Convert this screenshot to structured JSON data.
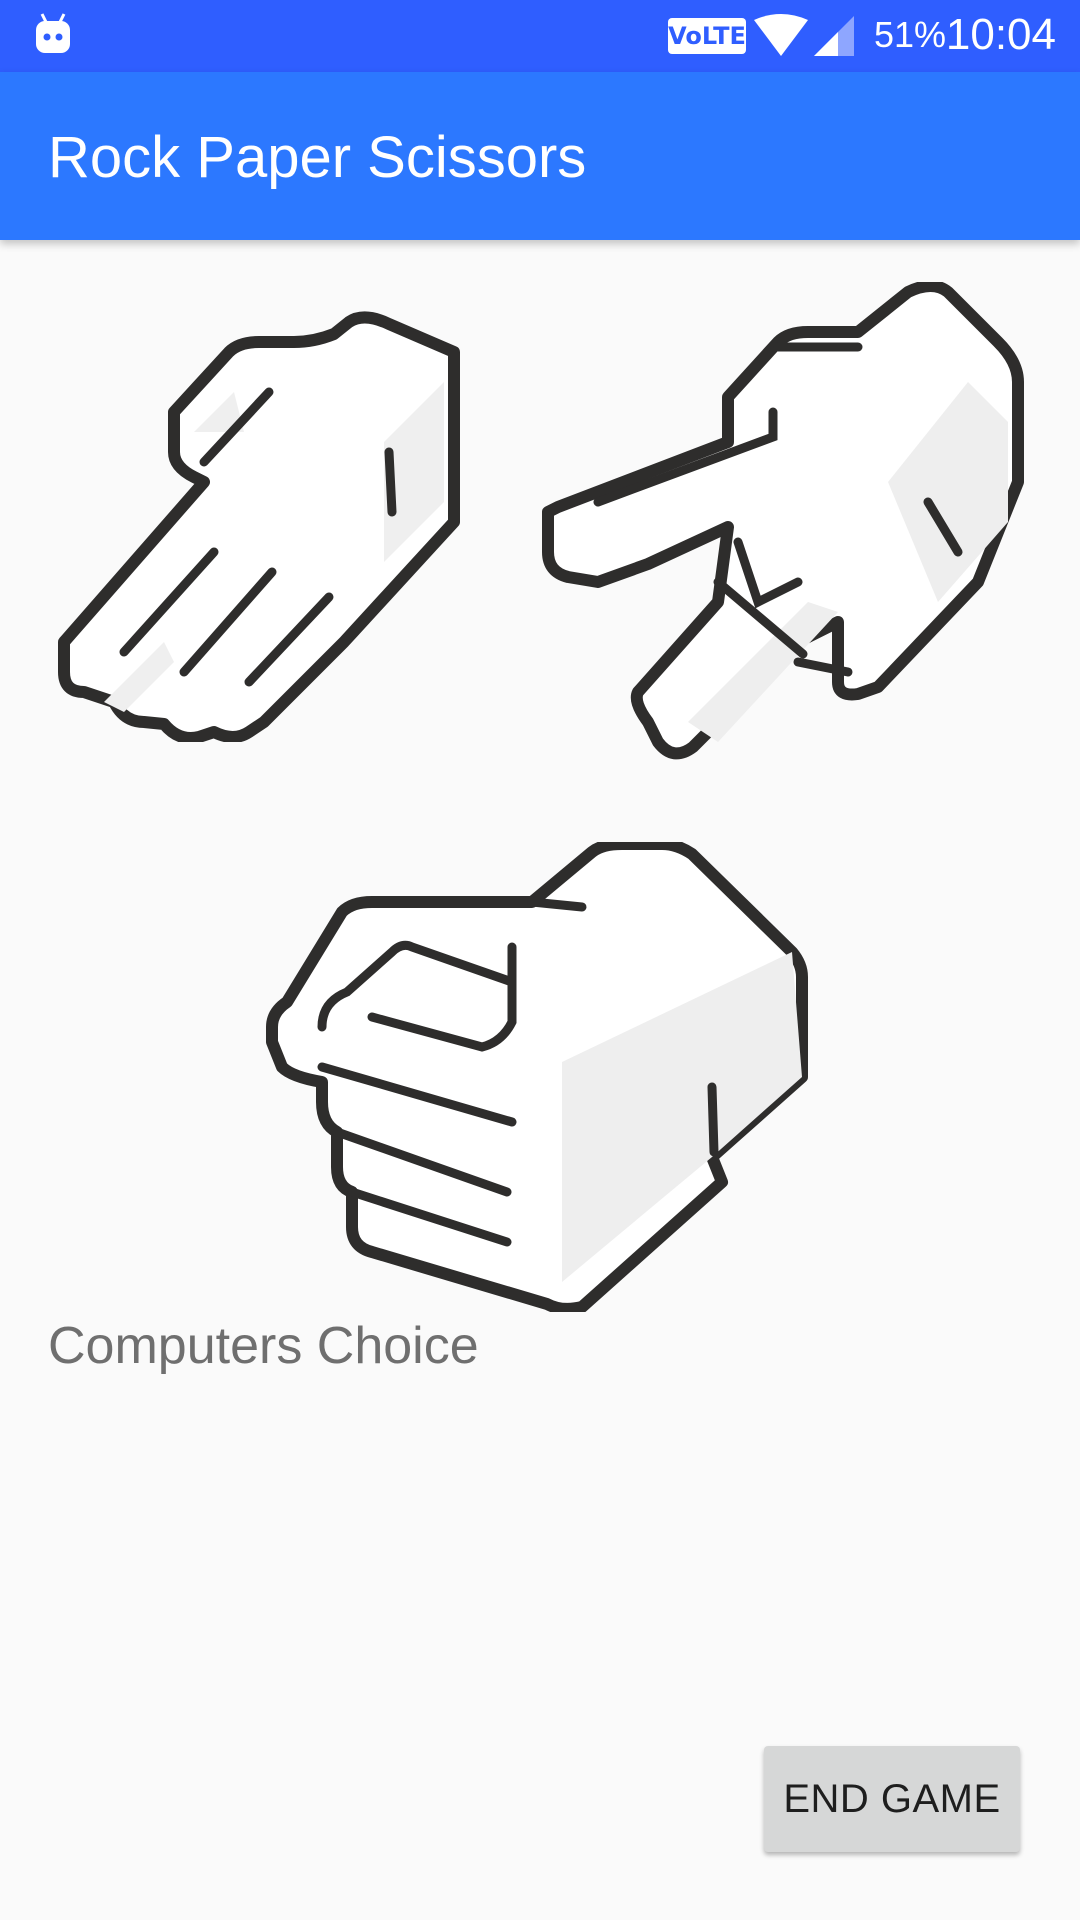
{
  "status_bar": {
    "notification_icon": "android-bot-icon",
    "network_badge": "VoLTE",
    "wifi_icon": "wifi-icon",
    "signal_icon": "cell-signal-icon",
    "battery_percent": "51%",
    "time": "10:04"
  },
  "app_bar": {
    "title": "Rock Paper Scissors",
    "color": "#2c78ff"
  },
  "choices": [
    {
      "id": "paper",
      "icon": "paper-hand-icon"
    },
    {
      "id": "scissors",
      "icon": "scissors-hand-icon"
    },
    {
      "id": "rock",
      "icon": "rock-fist-icon"
    }
  ],
  "result": {
    "label": "Computers Choice"
  },
  "actions": {
    "end_game_label": "END GAME"
  },
  "colors": {
    "status_bar": "#2f5eff",
    "accent": "#2c78ff",
    "background": "#fafafa",
    "button": "#d6d7d7"
  }
}
